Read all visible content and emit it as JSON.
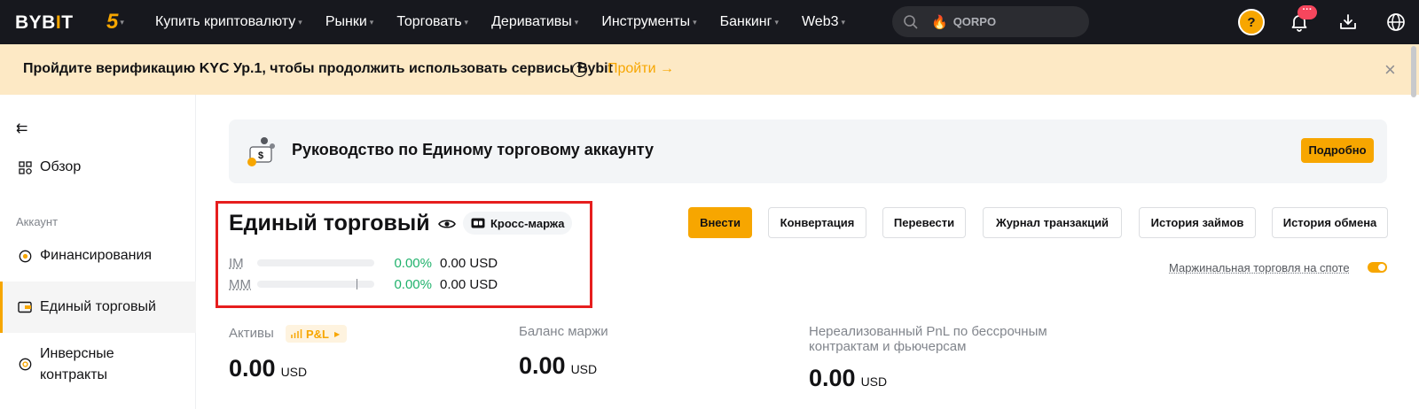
{
  "topbar": {
    "logo_main": "BYB",
    "logo_accent": "I",
    "logo_end": "T",
    "anniversary": "5",
    "nav": [
      {
        "label": "Купить криптовалюту"
      },
      {
        "label": "Рынки"
      },
      {
        "label": "Торговать"
      },
      {
        "label": "Деривативы"
      },
      {
        "label": "Инструменты"
      },
      {
        "label": "Банкинг"
      },
      {
        "label": "Web3"
      }
    ],
    "search_value": "QORPO",
    "search_icon": "search-icon",
    "notification_badge": "···",
    "avatar_label": "?"
  },
  "kyc": {
    "text": "Пройдите верификацию KYC Ур.1, чтобы продолжить использовать сервисы Bybit",
    "help": "?",
    "action": "Пройти →",
    "close": "×"
  },
  "sidebar": {
    "collapse": "⇇",
    "overview": "Обзор",
    "section": "Аккаунт",
    "items": [
      {
        "label": "Финансирования"
      },
      {
        "label": "Единый торговый"
      },
      {
        "label": "Инверсные контракты"
      }
    ]
  },
  "guide": {
    "title": "Руководство по Единому торговому аккаунту",
    "button": "Подробно"
  },
  "account": {
    "title": "Единый торговый",
    "margin_mode": "Кросс-маржа",
    "im": {
      "label": "IM",
      "pct": "0.00%",
      "amount": "0.00 USD",
      "fill": 0
    },
    "mm": {
      "label": "MM",
      "pct": "0.00%",
      "amount": "0.00 USD",
      "fill": 0
    }
  },
  "actions": [
    {
      "label": "Внести"
    },
    {
      "label": "Конвертация"
    },
    {
      "label": "Перевести"
    },
    {
      "label": "Журнал транзакций"
    },
    {
      "label": "История займов"
    },
    {
      "label": "История обмена"
    }
  ],
  "spot_margin": {
    "label": "Маржинальная торговля на споте",
    "enabled": true
  },
  "stats": {
    "assets_label": "Активы",
    "pnl_badge": "P&L",
    "assets_value": "0.00",
    "assets_currency": "USD",
    "margin_label": "Баланс маржи",
    "margin_value": "0.00",
    "margin_currency": "USD",
    "unrealized_label": "Нереализованный PnL по бессрочным контрактам и фьючерсам",
    "unrealized_value": "0.00",
    "unrealized_currency": "USD"
  },
  "colors": {
    "accent": "#f7a600",
    "positive": "#20b26c",
    "nav_bg": "#17181e",
    "banner_bg": "#fde9c5"
  }
}
